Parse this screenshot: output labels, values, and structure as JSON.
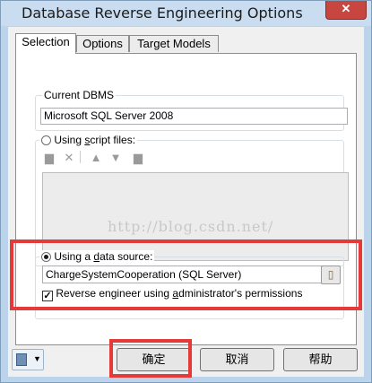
{
  "window": {
    "title": "Database Reverse Engineering Options",
    "close_symbol": "✕"
  },
  "tabs": [
    {
      "label": "Selection",
      "active": true
    },
    {
      "label": "Options",
      "active": false
    },
    {
      "label": "Target Models",
      "active": false
    }
  ],
  "current_dbms": {
    "label": "Current DBMS",
    "value": "Microsoft SQL Server 2008"
  },
  "script_files": {
    "label": "Using script files:",
    "selected": false,
    "toolbar_icons": [
      "add-file-icon",
      "delete-icon",
      "move-up-icon",
      "move-down-icon",
      "folder-icon"
    ]
  },
  "watermark": "http://blog.csdn.net/",
  "data_source": {
    "label": "Using a data source:",
    "selected": true,
    "value": "ChargeSystemCooperation (SQL Server)",
    "admin_checkbox_label": "Reverse engineer using administrator's permissions",
    "admin_checked": true
  },
  "buttons": {
    "ok": "确定",
    "cancel": "取消",
    "help": "帮助"
  },
  "colors": {
    "highlight": "#e53a3a",
    "close_button": "#c7463f"
  }
}
